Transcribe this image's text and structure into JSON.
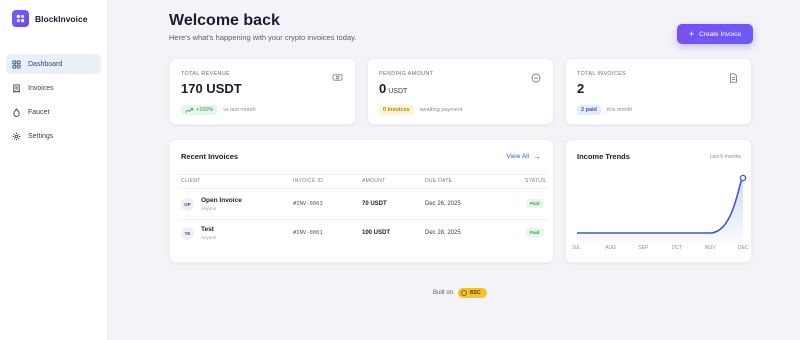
{
  "brand": {
    "name": "BlockInvoice"
  },
  "sidebar": {
    "items": [
      {
        "label": "Dashboard",
        "icon": "dashboard-icon",
        "active": true
      },
      {
        "label": "Invoices",
        "icon": "invoice-icon",
        "active": false
      },
      {
        "label": "Faucet",
        "icon": "droplet-icon",
        "active": false
      },
      {
        "label": "Settings",
        "icon": "gear-icon",
        "active": false
      }
    ]
  },
  "header": {
    "title": "Welcome back",
    "subtitle": "Here's what's happening with your crypto invoices today.",
    "create_label": "Create Invoice"
  },
  "stats": {
    "revenue": {
      "label": "TOTAL REVENUE",
      "value": "170 USDT",
      "badge": "+100%",
      "note": "vs last month",
      "icon": "coins-icon"
    },
    "pending": {
      "label": "PENDING AMOUNT",
      "value": "0",
      "unit": "USDT",
      "badge": "0 invoices",
      "note": "awaiting payment",
      "icon": "clock-icon"
    },
    "total": {
      "label": "TOTAL INVOICES",
      "value": "2",
      "badge": "2 paid",
      "note": "this month",
      "icon": "document-icon"
    }
  },
  "recent": {
    "title": "Recent Invoices",
    "view_all": "View All",
    "columns": [
      "CLIENT",
      "INVOICE ID",
      "AMOUNT",
      "DUE DATE",
      "STATUS"
    ],
    "rows": [
      {
        "initials": "OP",
        "client": "Open Invoice",
        "sub": "Anyone",
        "id": "#INV-0003",
        "amount": "70 USDT",
        "due": "Dec 26, 2025",
        "status": "Paid"
      },
      {
        "initials": "TE",
        "client": "Test",
        "sub": "Anyone",
        "id": "#INV-0001",
        "amount": "100 USDT",
        "due": "Dec 28, 2025",
        "status": "Paid"
      }
    ]
  },
  "trends": {
    "title": "Income Trends",
    "period": "Last 6 months",
    "accent": "#3b5bc4"
  },
  "chart_data": {
    "type": "area",
    "categories": [
      "JUL",
      "AUG",
      "SEP",
      "OCT",
      "NOV",
      "DEC"
    ],
    "values": [
      0,
      0,
      0,
      0,
      0,
      170
    ]
  },
  "footer": {
    "built_on": "Built on",
    "chain": "BSC"
  }
}
